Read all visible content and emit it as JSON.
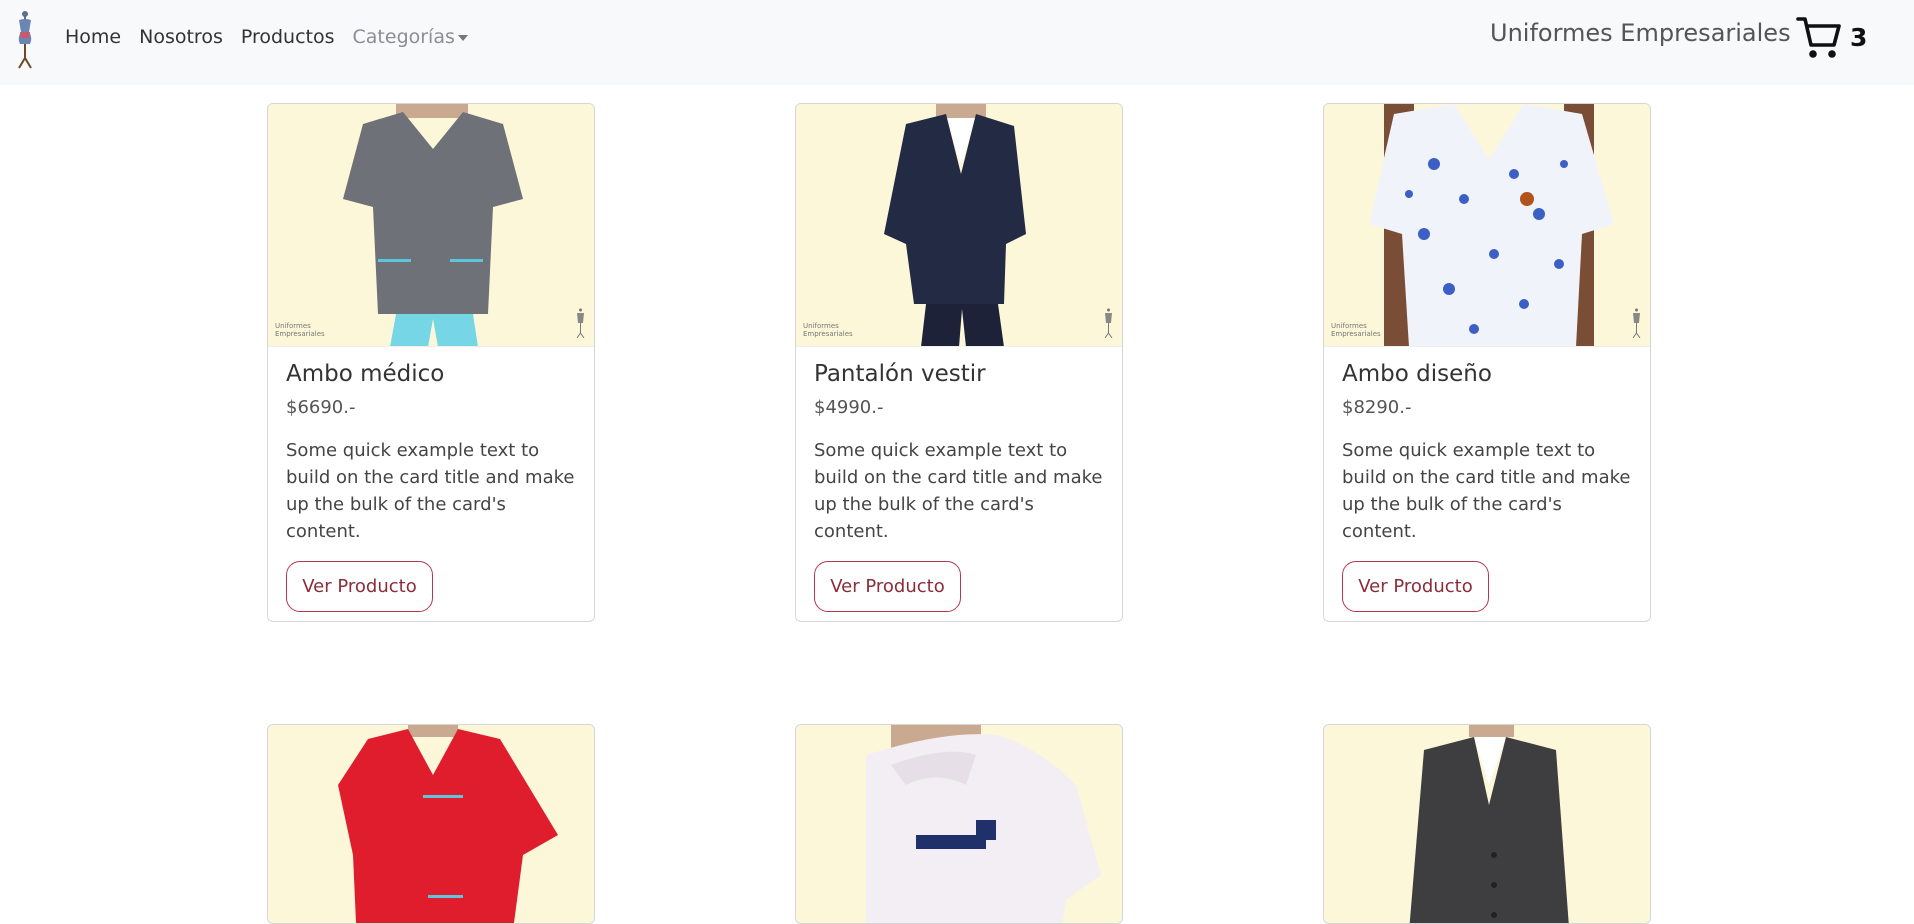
{
  "nav": {
    "links": [
      "Home",
      "Nosotros",
      "Productos"
    ],
    "dropdown_label": "Categorías",
    "brand_title": "Uniformes Empresariales",
    "cart_count": "3"
  },
  "products": [
    {
      "title": "Ambo médico",
      "price": "$6690.-",
      "text": "Some quick example text to build on the card title and make up the bulk of the card's content.",
      "button": "Ver Producto",
      "watermark": "Uniformes Empresariales"
    },
    {
      "title": "Pantalón vestir",
      "price": "$4990.-",
      "text": "Some quick example text to build on the card title and make up the bulk of the card's content.",
      "button": "Ver Producto",
      "watermark": "Uniformes Empresariales"
    },
    {
      "title": "Ambo diseño",
      "price": "$8290.-",
      "text": "Some quick example text to build on the card title and make up the bulk of the card's content.",
      "button": "Ver Producto",
      "watermark": "Uniformes Empresariales"
    }
  ],
  "colors": {
    "accent": "#b03a4a",
    "card_bg": "#fcf7d9",
    "navbar_bg": "#f8f9fa"
  },
  "icons": [
    "mannequin-logo-icon",
    "cart-icon",
    "chevron-down-icon"
  ]
}
